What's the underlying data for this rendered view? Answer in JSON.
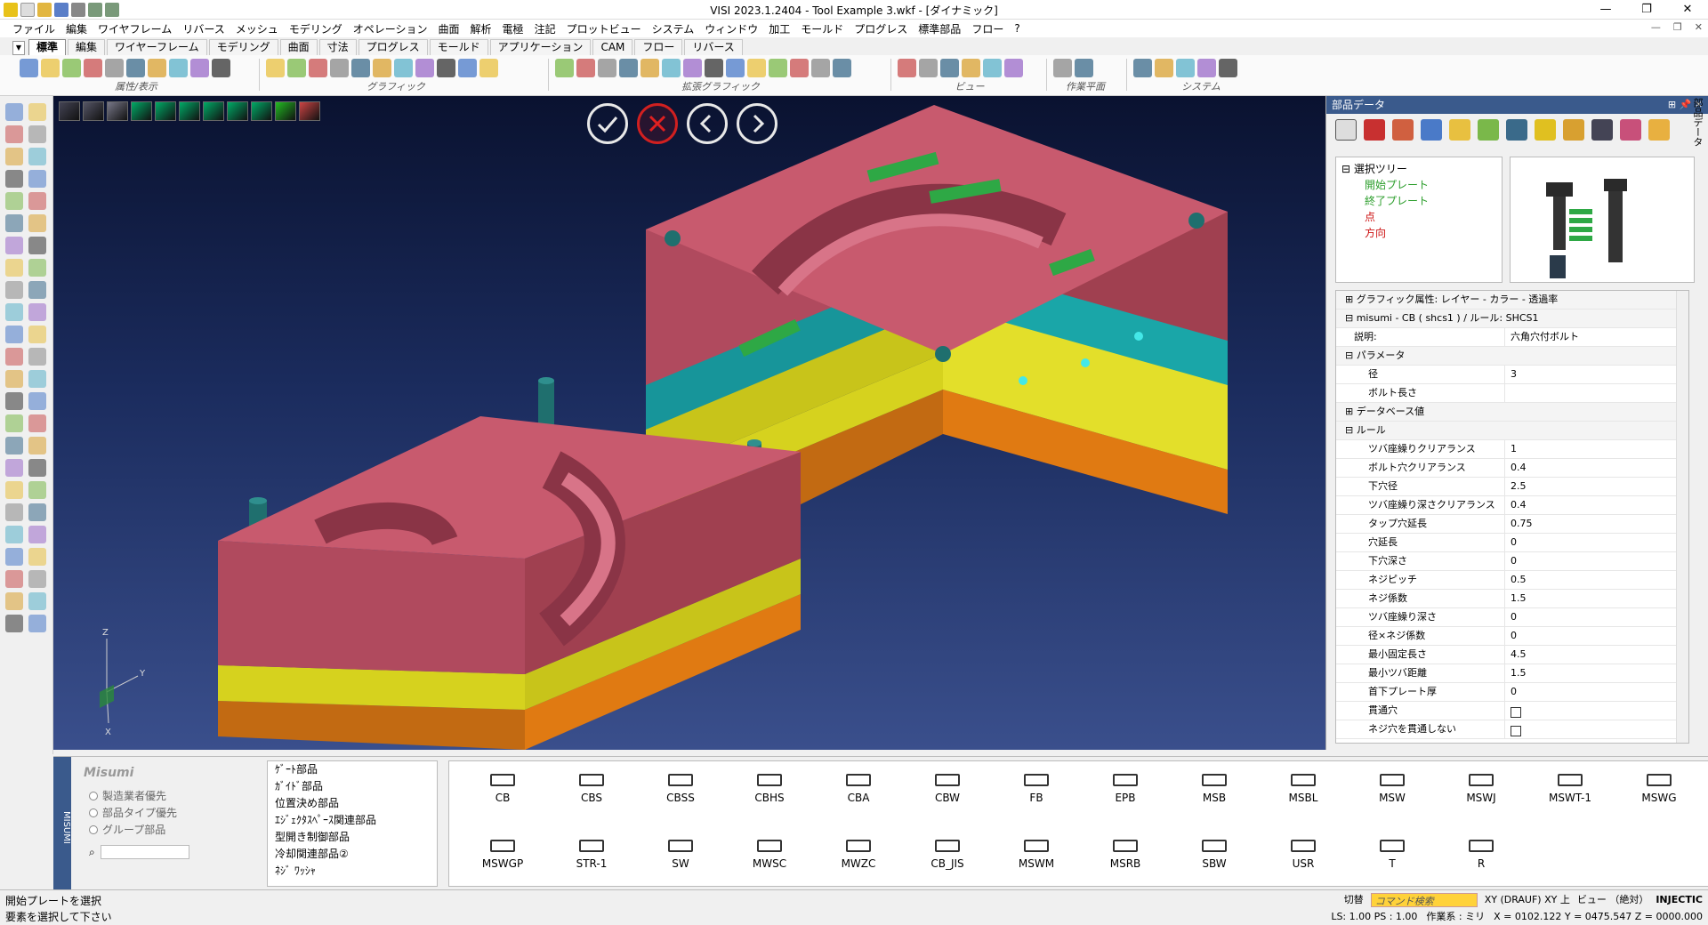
{
  "window": {
    "title": "VISI 2023.1.2404 - Tool Example 3.wkf - [ダイナミック]",
    "controls": [
      "—",
      "❐",
      "✕"
    ],
    "mdi_controls": [
      "—",
      "❐",
      "✕"
    ]
  },
  "menu": [
    "ファイル",
    "編集",
    "ワイヤフレーム",
    "リバース",
    "メッシュ",
    "モデリング",
    "オペレーション",
    "曲面",
    "解析",
    "電極",
    "注記",
    "プロットビュー",
    "システム",
    "ウィンドウ",
    "加工",
    "モールド",
    "プログレス",
    "標準部品",
    "フロー",
    "?"
  ],
  "tabs": [
    "標準",
    "編集",
    "ワイヤーフレーム",
    "モデリング",
    "曲面",
    "寸法",
    "プログレス",
    "モールド",
    "アプリケーション",
    "CAM",
    "フロー",
    "リバース"
  ],
  "active_tab": "標準",
  "ribbon_groups": [
    "属性/表示",
    "グラフィック",
    "拡張グラフィック",
    "ビュー",
    "作業平面",
    "システム"
  ],
  "viewport": {
    "confirm_buttons": [
      "ok",
      "cancel",
      "previous",
      "next"
    ],
    "axis_labels": [
      "Z",
      "Y",
      "X"
    ]
  },
  "parts_panel": {
    "title": "部品データ",
    "title_controls": [
      "⊞",
      "📌",
      "✕"
    ],
    "side_label": "部品データ",
    "tree": {
      "root": "選択ツリー",
      "items": [
        {
          "label": "開始プレート",
          "color": "#2a9d2a"
        },
        {
          "label": "終了プレート",
          "color": "#2a9d2a"
        },
        {
          "label": "点",
          "color": "#cc1111"
        },
        {
          "label": "方向",
          "color": "#cc1111"
        }
      ]
    },
    "properties": {
      "group1": "グラフィック属性: レイヤー - カラー - 透過率",
      "group2": "misumi - CB ( shcs1 ) / ルール: SHCS1",
      "description_label": "説明:",
      "description_value": "六角穴付ボルト",
      "params_label": "パラメータ",
      "params": [
        {
          "k": "径",
          "v": "3"
        },
        {
          "k": "ボルト長さ",
          "v": ""
        }
      ],
      "database_label": "データベース値",
      "rule_label": "ルール",
      "rules": [
        {
          "k": "ツバ座繰りクリアランス",
          "v": "1"
        },
        {
          "k": "ボルト穴クリアランス",
          "v": "0.4"
        },
        {
          "k": "下穴径",
          "v": "2.5"
        },
        {
          "k": "ツバ座繰り深さクリアランス",
          "v": "0.4"
        },
        {
          "k": "タップ穴延長",
          "v": "0.75"
        },
        {
          "k": "穴延長",
          "v": "0"
        },
        {
          "k": "下穴深さ",
          "v": "0"
        },
        {
          "k": "ネジピッチ",
          "v": "0.5"
        },
        {
          "k": "ネジ係数",
          "v": "1.5"
        },
        {
          "k": "ツバ座繰り深さ",
          "v": "0"
        },
        {
          "k": "径×ネジ係数",
          "v": "0"
        },
        {
          "k": "最小固定長さ",
          "v": "4.5"
        },
        {
          "k": "最小ツバ距離",
          "v": "1.5"
        },
        {
          "k": "首下プレート厚",
          "v": "0"
        }
      ],
      "checks": [
        {
          "k": "貫通穴",
          "checked": false
        },
        {
          "k": "ネジ穴を貫通しない",
          "checked": false
        }
      ]
    }
  },
  "misumi_panel": {
    "side_label": "MISUMI",
    "pin_label": "⊣",
    "logo": "Misumi",
    "radios": [
      "製造業者優先",
      "部品タイプ優先",
      "グループ部品"
    ],
    "categories": [
      "ｹﾞｰﾄ部品",
      "ｶﾞｲﾄﾞ部品",
      "位置決め部品",
      "ｴｼﾞｪｸﾀｽﾍﾟｰｽ関連部品",
      "型開き制御部品",
      "冷却関連部品②",
      "ﾈｼﾞ ﾜｯｼｬ"
    ],
    "parts_row1": [
      "CB",
      "CBS",
      "CBSS",
      "CBHS",
      "CBA",
      "CBW",
      "FB",
      "EPB",
      "MSB",
      "MSBL",
      "MSW",
      "MSWJ",
      "MSWT-1",
      "MSWG"
    ],
    "parts_row2": [
      "MSWGP",
      "STR-1",
      "SW",
      "MWSC",
      "MWZC",
      "CB_JIS",
      "MSWM",
      "MSRB",
      "SBW",
      "USR",
      "T",
      "R"
    ]
  },
  "status": {
    "line1": "開始プレートを選択",
    "line2": "要素を選択して下さい",
    "cut_label": "切替",
    "command_placeholder": "コマンド検索",
    "view_info": "XY (DRAUF) XY 上",
    "view_mode": "ビュー （絶対）",
    "injectic": "INJECTIC",
    "ls_ps": "LS: 1.00 PS : 1.00",
    "unit": "作業系 : ミリ",
    "coords": "X = 0102.122 Y = 0475.547 Z = 0000.000"
  },
  "colors": {
    "viewport_top": "#0a1230",
    "viewport_bottom": "#3a4f8c",
    "mold_pink": "#c85a6e",
    "plate_teal": "#1aa6a8",
    "plate_yellow": "#d6d21e",
    "plate_orange": "#e07a12",
    "pin_teal": "#1f6f6e",
    "panel_header": "#3a5a8c"
  }
}
